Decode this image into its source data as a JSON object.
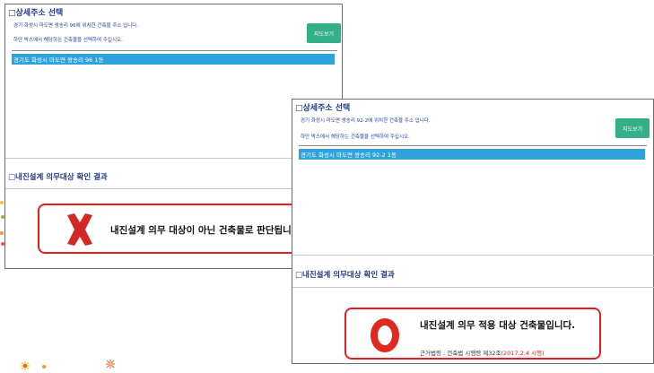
{
  "panel1": {
    "heading": "□상세주소 선택",
    "desc1": "경기 화성시 마도면 쌍송리 96에 위치한 건축물 주소 입니다.",
    "desc2": "하단 박스에서 해당하는 건축물을 선택하여 주십시오.",
    "map_button": "지도보기",
    "selected_address": "경기도 화성시 마도면 쌍송리 96 1동",
    "result_heading": "□내진설계 의무대상 확인 결과",
    "result_text": "내진설계 의무 대상이 아닌 건축물로 판단됩니다."
  },
  "panel2": {
    "heading": "□상세주소 선택",
    "desc1": "경기 화성시 마도면 쌍송리 92-2에 위치한 건축물 주소 입니다.",
    "desc2": "하단 박스에서 해당하는 건축물을 선택하여 주십시오.",
    "map_button": "지도보기",
    "selected_address": "경기도 화성시 마도면 쌍송리 92-2 1동",
    "result_heading": "□내진설계 의무대상 확인 결과",
    "result_text": "내진설계 의무 적용 대상 건축물입니다.",
    "legal_basis": "근거법령 : 건축법 시행령 제32조",
    "legal_date": "(2017.2.4 시행)"
  },
  "colors": {
    "heading": "#223a8c",
    "map_button": "#33b088",
    "selected_row": "#2fa1dc",
    "result_border": "#e02020",
    "x_mark": "#d42727",
    "o_mark": "#e02a1f"
  },
  "icons": {
    "x_mark": "x-mark-icon",
    "o_mark": "o-mark-icon"
  }
}
